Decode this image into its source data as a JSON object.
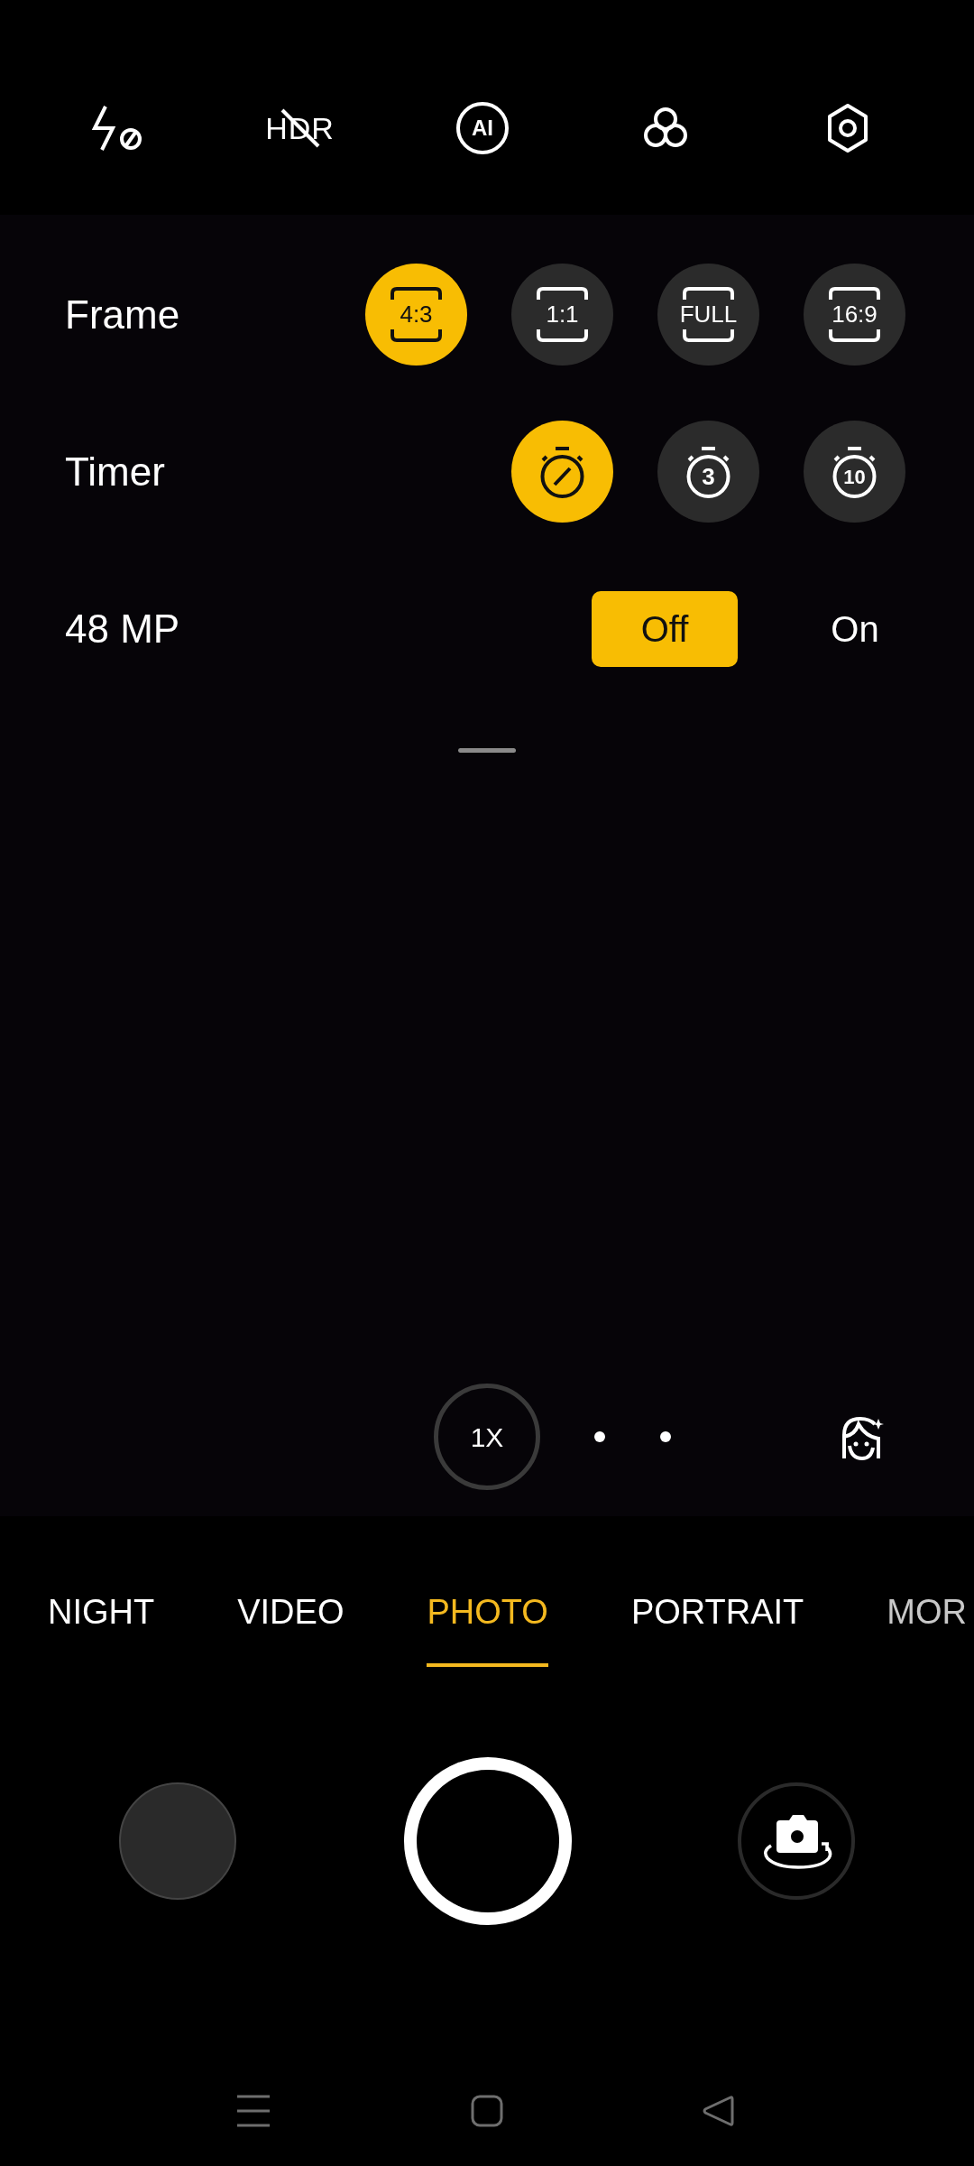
{
  "top_bar": [
    {
      "kind": "flash_off"
    },
    {
      "kind": "slashed_text",
      "label": "HDR"
    },
    {
      "kind": "circled_text",
      "label": "AI"
    },
    {
      "kind": "filters"
    },
    {
      "kind": "settings"
    }
  ],
  "settings": [
    {
      "label": "Frame",
      "kind": "frame",
      "options": [
        {
          "label": "4:3",
          "selected": true
        },
        {
          "label": "1:1",
          "selected": false
        },
        {
          "label": "FULL",
          "selected": false
        },
        {
          "label": "16:9",
          "selected": false
        }
      ]
    },
    {
      "label": "Timer",
      "kind": "timer",
      "options": [
        {
          "kind": "off",
          "selected": true
        },
        {
          "kind": "seconds",
          "label": "3",
          "selected": false
        },
        {
          "kind": "seconds",
          "label": "10",
          "selected": false
        }
      ]
    },
    {
      "label": "48 MP",
      "kind": "toggle",
      "options": [
        {
          "label": "Off",
          "selected": true
        },
        {
          "label": "On",
          "selected": false
        }
      ]
    }
  ],
  "zoom": {
    "label": "1X"
  },
  "modes": [
    {
      "label": "NIGHT",
      "selected": false
    },
    {
      "label": "VIDEO",
      "selected": false
    },
    {
      "label": "PHOTO",
      "selected": true
    },
    {
      "label": "PORTRAIT",
      "selected": false
    },
    {
      "label": "MOR",
      "selected": false
    }
  ]
}
